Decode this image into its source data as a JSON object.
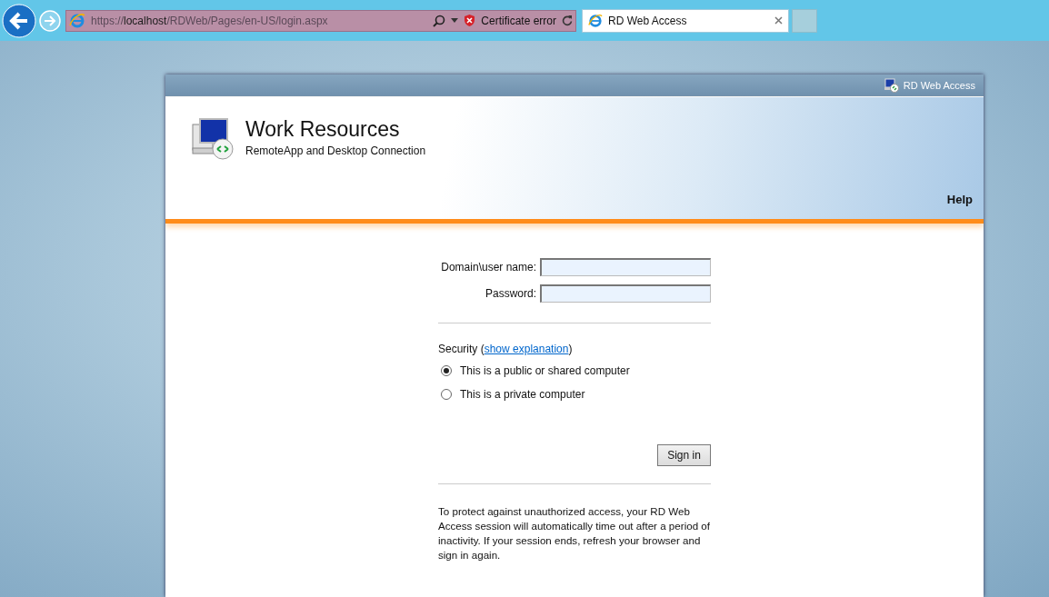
{
  "browser": {
    "address": "https://**localhost**/RDWeb/Pages/en-US/login.aspx",
    "certificate_error": "Certificate error",
    "tabs": [
      {
        "label": "RD Web Access",
        "selected": true
      }
    ]
  },
  "site": {
    "top_bar_title": "RD Web Access",
    "title": "Work Resources",
    "subtitle": "RemoteApp and Desktop Connection",
    "help": "Help"
  },
  "form": {
    "fields": [
      {
        "label": "Domain\\user name:"
      },
      {
        "label": "Password:"
      }
    ],
    "security_label": "Security (",
    "security_link": "show explanation",
    "security_suffix": ")",
    "options": [
      {
        "label": "This is a public or shared computer",
        "selected": true
      },
      {
        "label": "This is a private computer",
        "selected": false
      }
    ],
    "sign_in": "Sign in",
    "notice": "To protect against unauthorized access, your RD Web Access session will automatically time out after a period of inactivity. If your session ends, refresh your browser and sign in again."
  }
}
